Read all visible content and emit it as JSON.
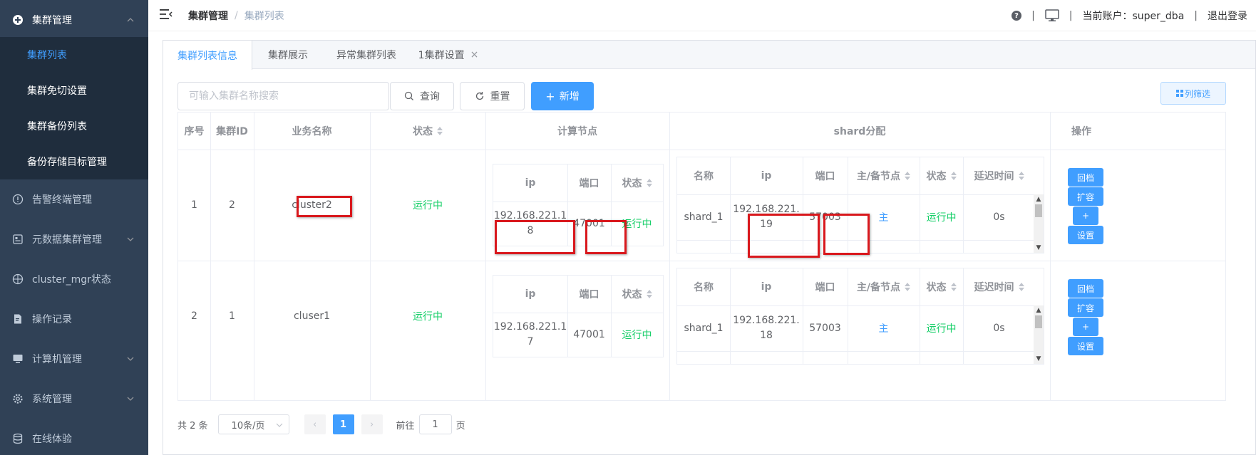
{
  "sidebar": {
    "group_cluster": "集群管理",
    "sub_items": [
      "集群列表",
      "集群免切设置",
      "集群备份列表",
      "备份存储目标管理"
    ],
    "items": [
      "告警终端管理",
      "元数据集群管理",
      "cluster_mgr状态",
      "操作记录",
      "计算机管理",
      "系统管理",
      "在线体验"
    ]
  },
  "header": {
    "breadcrumb_root": "集群管理",
    "breadcrumb_sep": "/",
    "breadcrumb_current": "集群列表",
    "help": "?",
    "separator": "|",
    "account": "当前账户：super_dba",
    "logout": "退出登录"
  },
  "tabs": [
    "集群列表信息",
    "集群展示",
    "异常集群列表",
    "1集群设置"
  ],
  "tab_close": "×",
  "toolbar": {
    "search_placeholder": "可输入集群名称搜索",
    "query": "查询",
    "reset": "重置",
    "add": "新增",
    "add_prefix": "+",
    "column_filter": "列筛选"
  },
  "table": {
    "headers": {
      "index": "序号",
      "cluster_id": "集群ID",
      "business_name": "业务名称",
      "status": "状态",
      "compute_nodes": "计算节点",
      "shard": "shard分配",
      "operation": "操作"
    },
    "compute_headers": {
      "ip": "ip",
      "port": "端口",
      "status": "状态"
    },
    "shard_headers": {
      "name": "名称",
      "ip": "ip",
      "port": "端口",
      "role": "主/备节点",
      "status": "状态",
      "delay": "延迟时间"
    },
    "ops": {
      "rollback": "回档",
      "expand": "扩容",
      "plus": "+",
      "settings": "设置"
    },
    "rows": [
      {
        "index": "1",
        "cluster_id": "2",
        "name": "cluster2",
        "status": "运行中",
        "compute": {
          "ip_line1": "192.168.221.1",
          "ip_line2": "8",
          "port": "47001",
          "status": "运行中"
        },
        "shard": {
          "name": "shard_1",
          "ip_line1": "192.168.221.",
          "ip_line2": "19",
          "port": "57003",
          "role": "主",
          "status": "运行中",
          "delay": "0s"
        }
      },
      {
        "index": "2",
        "cluster_id": "1",
        "name": "cluser1",
        "status": "运行中",
        "compute": {
          "ip_line1": "192.168.221.1",
          "ip_line2": "7",
          "port": "47001",
          "status": "运行中"
        },
        "shard": {
          "name": "shard_1",
          "ip_line1": "192.168.221.",
          "ip_line2": "18",
          "port": "57003",
          "role": "主",
          "status": "运行中",
          "delay": "0s"
        }
      }
    ]
  },
  "pagination": {
    "total": "共 2 条",
    "page_size": "10条/页",
    "current_page": "1",
    "goto_label": "前往",
    "goto_value": "1",
    "page_suffix": "页",
    "prev": "‹",
    "next": "›"
  },
  "colors": {
    "sidebar_bg": "#304156",
    "submenu_bg": "#1f2d3d",
    "primary": "#409eff",
    "success": "#13ce66",
    "highlight_box": "#d9181d"
  }
}
